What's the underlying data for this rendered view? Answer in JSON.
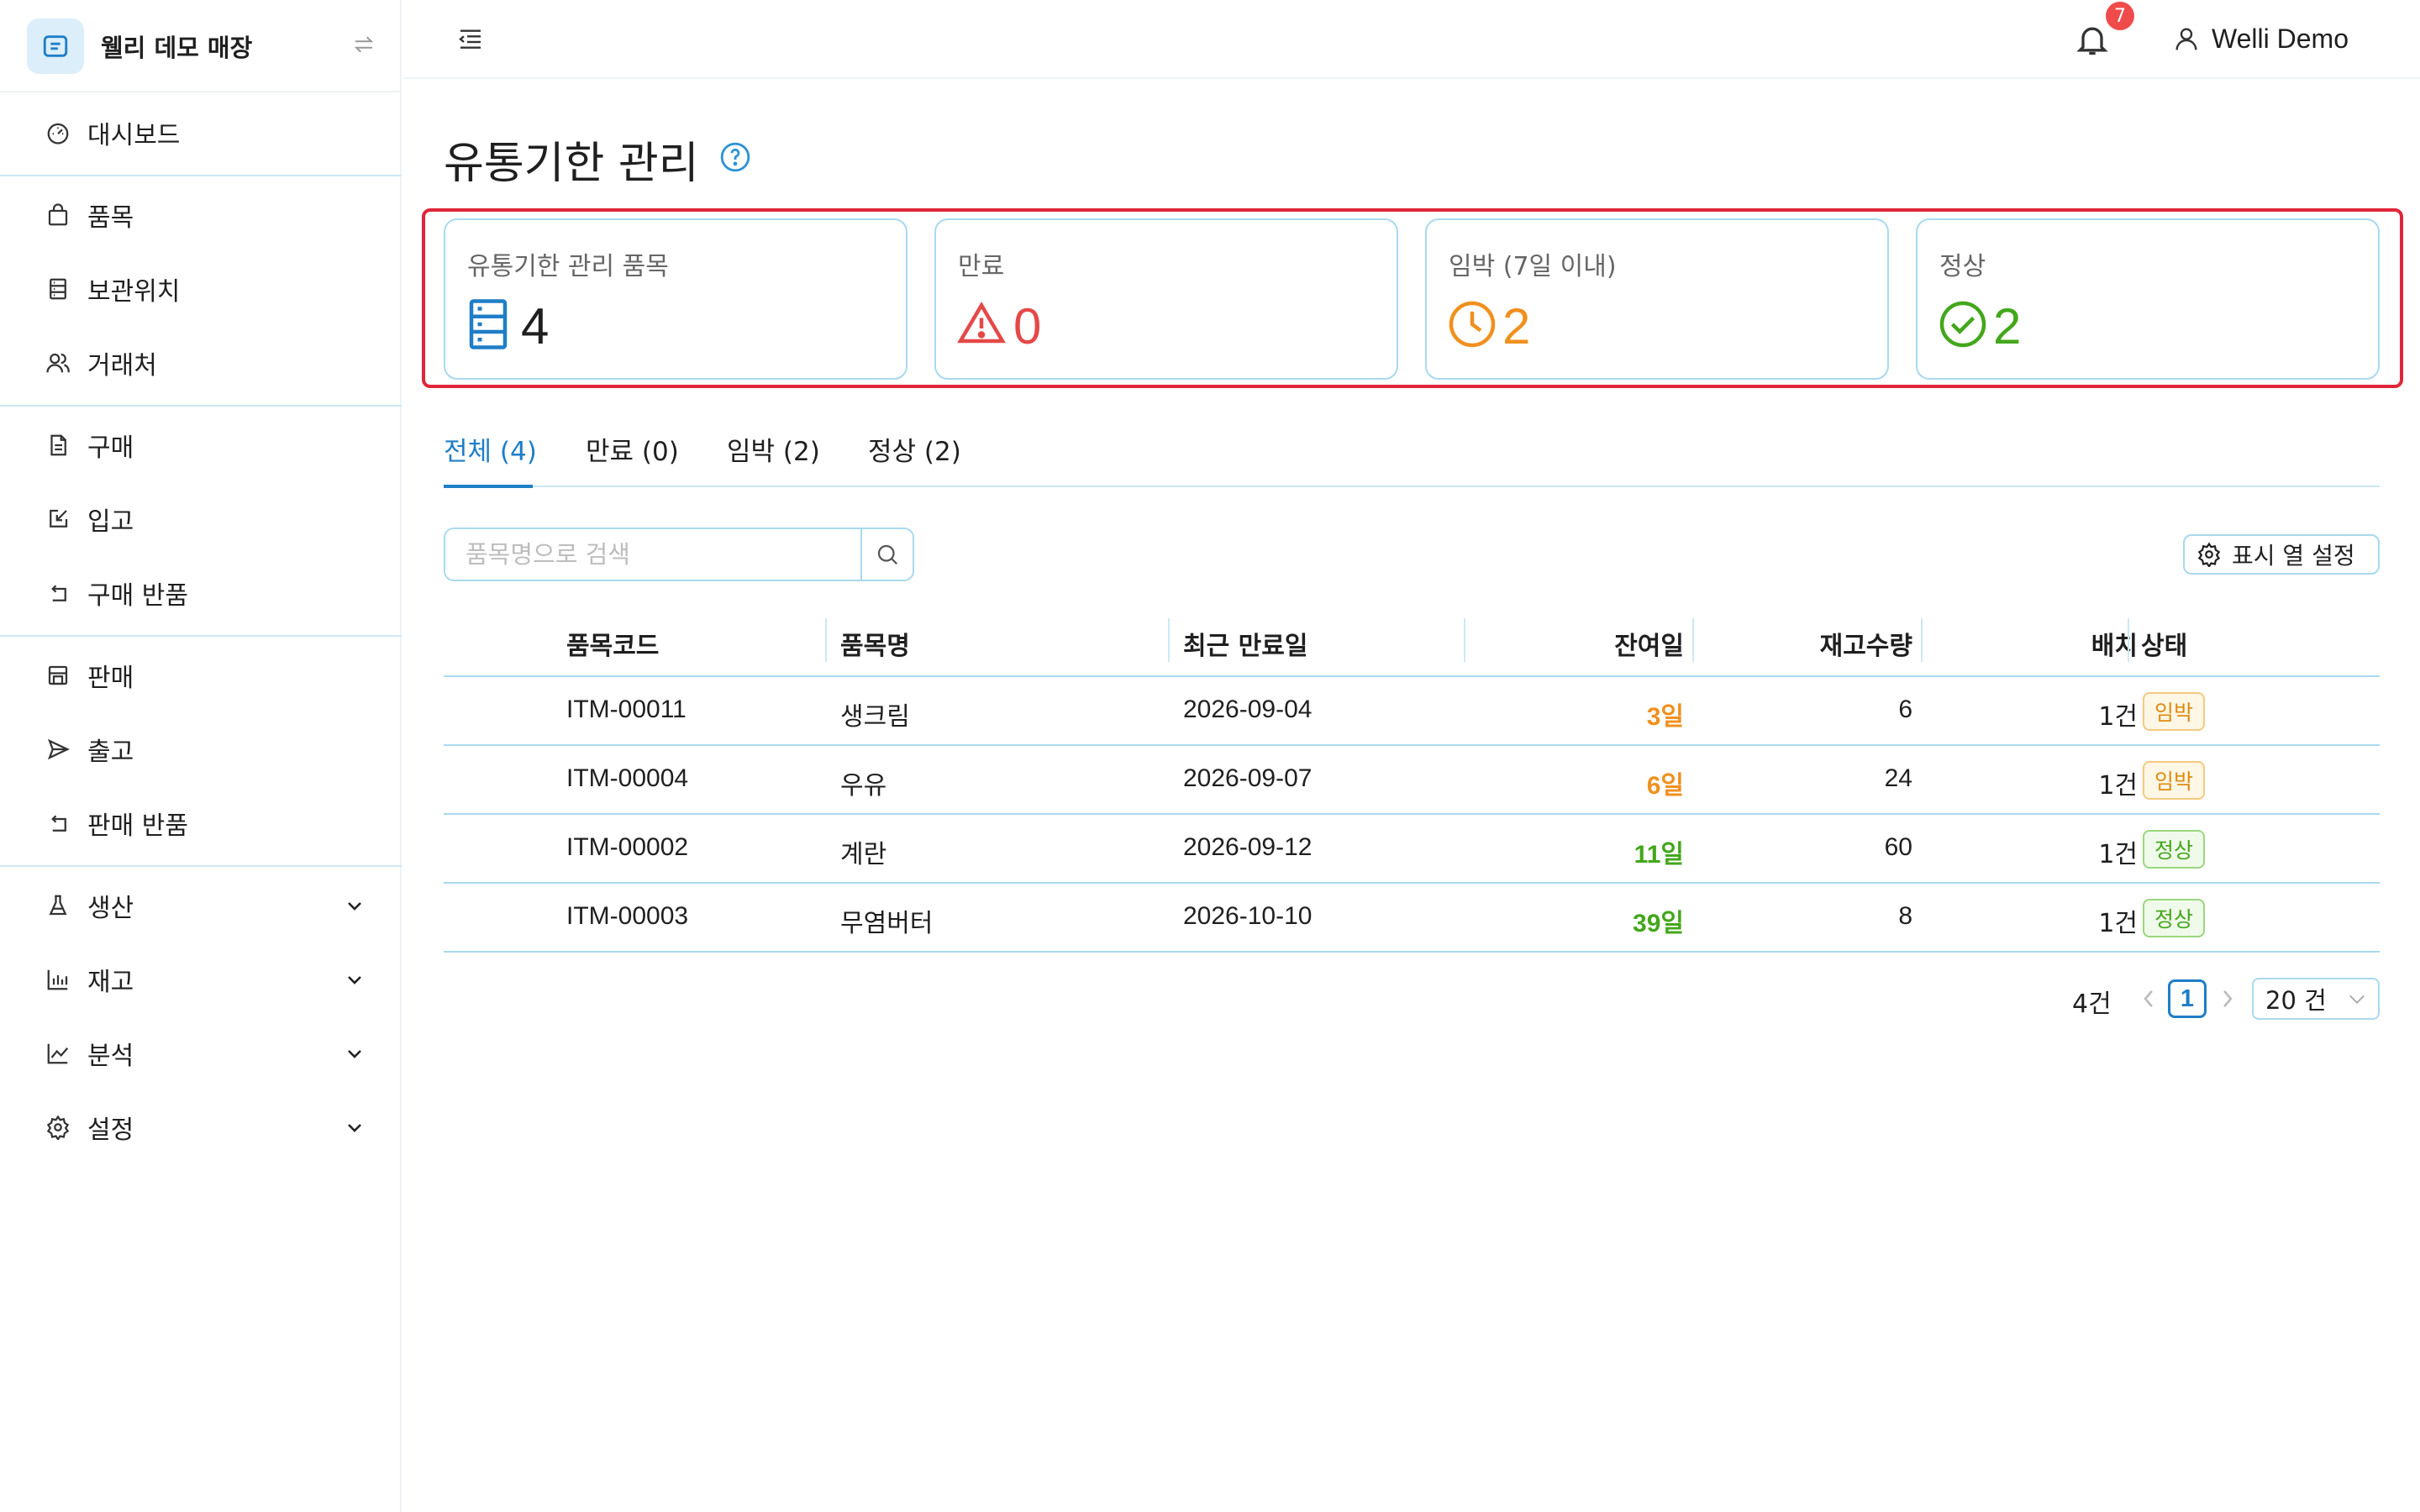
{
  "app": {
    "store_name": "웰리 데모 매장",
    "user_name": "Welli Demo",
    "notification_count": "7"
  },
  "sidebar": {
    "items": [
      {
        "label": "대시보드",
        "icon": "dashboard-icon"
      },
      {
        "label": "품목",
        "icon": "bag-icon"
      },
      {
        "label": "보관위치",
        "icon": "storage-icon"
      },
      {
        "label": "거래처",
        "icon": "people-icon"
      },
      {
        "label": "구매",
        "icon": "document-icon"
      },
      {
        "label": "입고",
        "icon": "edit-in-icon"
      },
      {
        "label": "구매 반품",
        "icon": "return-icon"
      },
      {
        "label": "판매",
        "icon": "shop-icon"
      },
      {
        "label": "출고",
        "icon": "send-icon"
      },
      {
        "label": "판매 반품",
        "icon": "return-icon"
      },
      {
        "label": "생산",
        "icon": "flask-icon"
      },
      {
        "label": "재고",
        "icon": "bar-chart-icon"
      },
      {
        "label": "분석",
        "icon": "line-chart-icon"
      },
      {
        "label": "설정",
        "icon": "gear-icon"
      }
    ]
  },
  "page": {
    "title": "유통기한 관리"
  },
  "stats": [
    {
      "label": "유통기한 관리 품목",
      "value": "4",
      "icon": "database-icon",
      "color": "#1f7ec7"
    },
    {
      "label": "만료",
      "value": "0",
      "icon": "warning-icon",
      "color": "#e54848"
    },
    {
      "label": "임박 (7일 이내)",
      "value": "2",
      "icon": "clock-icon",
      "color": "#f0901e"
    },
    {
      "label": "정상",
      "value": "2",
      "icon": "check-circle-icon",
      "color": "#43a71b"
    }
  ],
  "tabs": [
    {
      "label": "전체 (4)"
    },
    {
      "label": "만료 (0)"
    },
    {
      "label": "임박 (2)"
    },
    {
      "label": "정상 (2)"
    }
  ],
  "search": {
    "placeholder": "품목명으로 검색"
  },
  "column_settings_label": "표시 열 설정",
  "table": {
    "headers": [
      "품목코드",
      "품목명",
      "최근 만료일",
      "잔여일",
      "재고수량",
      "배치",
      "상태"
    ],
    "rows": [
      {
        "code": "ITM-00011",
        "name": "생크림",
        "expiry": "2026-09-04",
        "days": "3일",
        "stock": "6",
        "batch": "1건",
        "status": "임박"
      },
      {
        "code": "ITM-00004",
        "name": "우유",
        "expiry": "2026-09-07",
        "days": "6일",
        "stock": "24",
        "batch": "1건",
        "status": "임박"
      },
      {
        "code": "ITM-00002",
        "name": "계란",
        "expiry": "2026-09-12",
        "days": "11일",
        "stock": "60",
        "batch": "1건",
        "status": "정상"
      },
      {
        "code": "ITM-00003",
        "name": "무염버터",
        "expiry": "2026-10-10",
        "days": "39일",
        "stock": "8",
        "batch": "1건",
        "status": "정상"
      }
    ]
  },
  "pagination": {
    "total": "4건",
    "current_page": "1",
    "page_size": "20 건"
  },
  "colors": {
    "accent": "#1f7ec7",
    "warning": "#f0901e",
    "ok": "#43a71b",
    "danger": "#e54848"
  }
}
